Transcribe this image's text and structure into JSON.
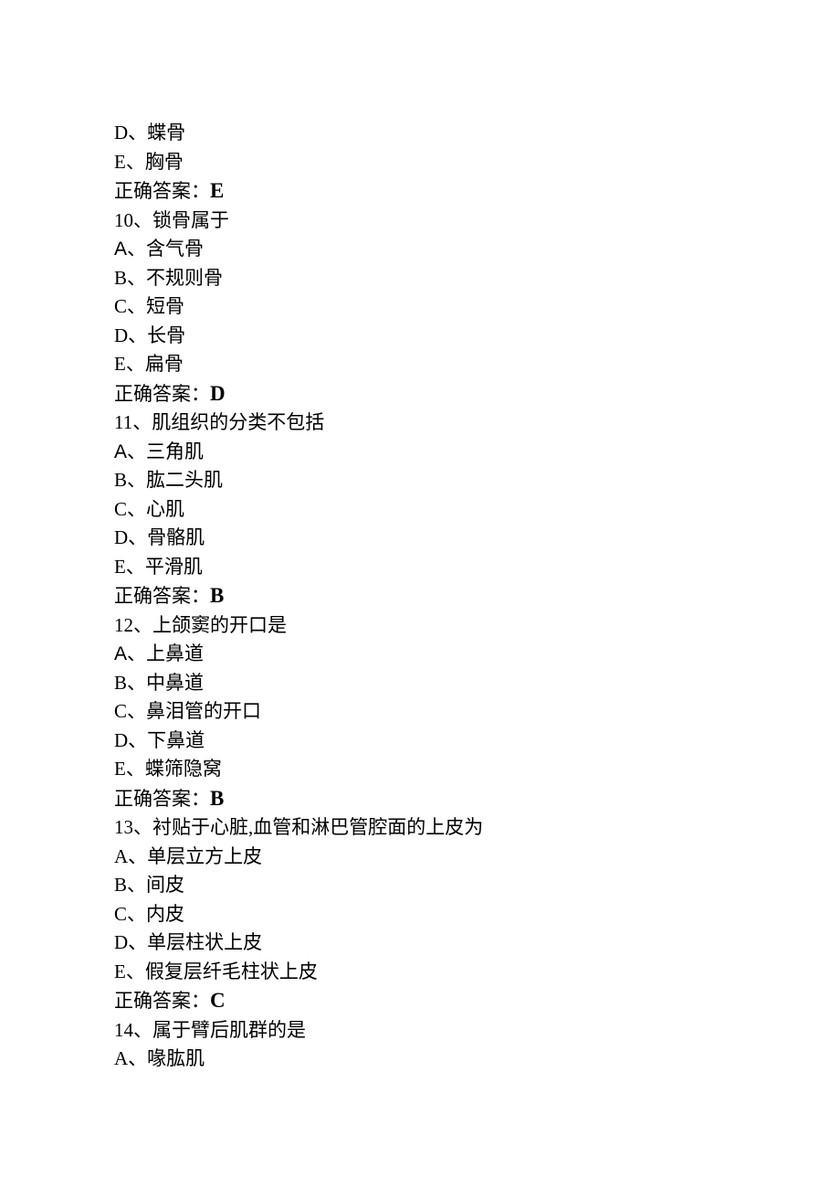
{
  "lines": {
    "l1": "D、蝶骨",
    "l2": "E、胸骨",
    "l3_label": "正确答案：",
    "l3_answer": "E",
    "l4": "10、锁骨属于",
    "l5_letter": "A",
    "l5_rest": "、含气骨",
    "l6": "B、不规则骨",
    "l7": "C、短骨",
    "l8": "D、长骨",
    "l9": "E、扁骨",
    "l10_label": "正确答案：",
    "l10_answer": "D",
    "l11": "11、肌组织的分类不包括",
    "l12_letter": "A",
    "l12_rest": "、三角肌",
    "l13": "B、肱二头肌",
    "l14": "C、心肌",
    "l15": "D、骨骼肌",
    "l16": "E、平滑肌",
    "l17_label": "正确答案：",
    "l17_answer": "B",
    "l18": "12、上颌窦的开口是",
    "l19_letter": "A",
    "l19_rest": "、上鼻道",
    "l20": "B、中鼻道",
    "l21": "C、鼻泪管的开口",
    "l22": "D、下鼻道",
    "l23": "E、蝶筛隐窝",
    "l24_label": "正确答案：",
    "l24_answer": "B",
    "l25": "13、衬贴于心脏,血管和淋巴管腔面的上皮为",
    "l26": "A、单层立方上皮",
    "l27": "B、间皮",
    "l28": "C、内皮",
    "l29": "D、单层柱状上皮",
    "l30": "E、假复层纤毛柱状上皮",
    "l31_label": "正确答案：",
    "l31_answer": "C",
    "l32": "14、属于臂后肌群的是",
    "l33": "A、喙肱肌"
  }
}
